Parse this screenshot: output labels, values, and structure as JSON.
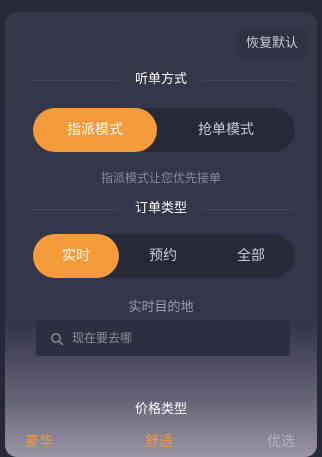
{
  "header": {
    "reset_label": "恢复默认"
  },
  "dispatch": {
    "title": "听单方式",
    "options": [
      {
        "label": "指派模式",
        "active": true
      },
      {
        "label": "抢单模式",
        "active": false
      }
    ],
    "hint": "指派模式让您优先接单"
  },
  "order_type": {
    "title": "订单类型",
    "options": [
      {
        "label": "实时",
        "active": true
      },
      {
        "label": "预约",
        "active": false
      },
      {
        "label": "全部",
        "active": false
      }
    ]
  },
  "destination": {
    "title": "实时目的地",
    "placeholder": "现在要去哪",
    "icon": "search-icon"
  },
  "price_type": {
    "title": "价格类型",
    "options": [
      {
        "label": "豪华",
        "color": "#f39a3b"
      },
      {
        "label": "舒适",
        "color": "#f39a3b"
      },
      {
        "label": "优选",
        "color": "#b9b4c0"
      }
    ]
  },
  "colors": {
    "accent": "#f39a3b",
    "panel": "#343748",
    "pill_bg": "#262938"
  }
}
